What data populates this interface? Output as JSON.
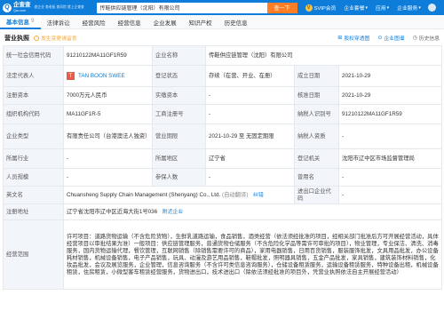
{
  "header": {
    "logo_cn": "企查查",
    "logo_en": "Qcc.com",
    "slogan": "查企业 查老板 查风险 就上企查查",
    "search_value": "传鞋供应链管理（沈阳）有限公司",
    "search_button": "查一下",
    "menu": [
      "SVIP会员",
      "企业套餐",
      "应用",
      "企业服务"
    ]
  },
  "tabs": [
    {
      "label": "基本信息",
      "count": "9"
    },
    {
      "label": "法律诉讼",
      "count": ""
    },
    {
      "label": "经营风险",
      "count": ""
    },
    {
      "label": "经营信息",
      "count": ""
    },
    {
      "label": "企业发展",
      "count": ""
    },
    {
      "label": "知识产权",
      "count": ""
    },
    {
      "label": "历史信息",
      "count": ""
    }
  ],
  "section": {
    "title": "营业执照",
    "notice": "发生变更请留意",
    "actions": [
      "股权穿透图",
      "企业图谱",
      "历史信息"
    ]
  },
  "info": {
    "credit_code_label": "统一社会信用代码",
    "credit_code": "91210122MA11GF1R59",
    "name_label": "企业名称",
    "name": "传鞋供应链管理（沈阳）有限公司",
    "rep_label": "法定代表人",
    "rep_avatar": "T",
    "rep_name": "TAN BOON SWEE",
    "reg_status_label": "登记状态",
    "reg_status": "存续（在营、开业、在册）",
    "found_label": "成立日期",
    "found_date": "2021-10-29",
    "capital_label": "注册资本",
    "capital": "7000万元人民币",
    "paid_label": "实缴资本",
    "paid": "-",
    "approve_label": "核准日期",
    "approve_date": "2021-10-29",
    "org_code_label": "组织机构代码",
    "org_code": "MA11GF1R-5",
    "biz_no_label": "工商注册号",
    "biz_no": "-",
    "tax_no_label": "纳税人识别号",
    "tax_no": "91210122MA11GF1R59",
    "type_label": "企业类型",
    "type": "有限责任公司（台港澳法人独资）",
    "term_label": "营业期限",
    "term": "2021-10-29 至 无固定期限",
    "taxpayer_label": "纳税人资质",
    "taxpayer": "-",
    "industry_label": "所属行业",
    "industry": "-",
    "region_label": "所属地区",
    "region": "辽宁省",
    "authority_label": "登记机关",
    "authority": "沈阳市辽中区市场监督管理局",
    "staff_label": "人员规模",
    "staff": "-",
    "insured_label": "参保人数",
    "insured": "-",
    "former_label": "曾用名",
    "former": "-",
    "en_label": "英文名",
    "en_name": "Chuansheng Supply Chain Management (Shenyang) Co., Ltd.",
    "en_note": "(自动翻译)",
    "en_feedback": "纠错",
    "io_label": "进出口企业代码",
    "io_code": "-",
    "address_label": "注册地址",
    "address": "辽宁省沈阳市辽中区近海大街1号036",
    "address_link": "附近企业",
    "scope_label": "经营范围",
    "scope": "许可项目：道路货物运输（不含危险货物），生鲜乳道路运输，食品销售，酒类经营（依法须经批准的项目，经相关部门批准后方可开展经营活动，具体经营项目以审批结果为准）一般项目：供应链管理服务，普通货物仓储服务（不含危险化学品等需许可审批的项目），物业管理，专业保洁、清洗、消毒服务，国内货物运输代理，餐饮管理，互联网销售（除销售需要许可的商品），家用电器销售，日用百货销售，服装服饰批发，文具用品批发，办公设备耗材销售，机械设备销售，电子产品销售，玩具、动漫及游艺用品销售，鞋帽批发，照明器具销售，五金产品批发，家具销售，建筑装饰材料销售，化妆品批发，会议及展览服务，企业管理，信息咨询服务（不含许可类信息咨询服务），仓储设备租赁服务，运输设备租赁服务，特种设备出租，机械设备租赁，住房租赁，小微型客车租赁经营服务，货物进出口，技术进出口（除依法须经批准的项目外，凭营业执照依法自主开展经营活动）"
  }
}
